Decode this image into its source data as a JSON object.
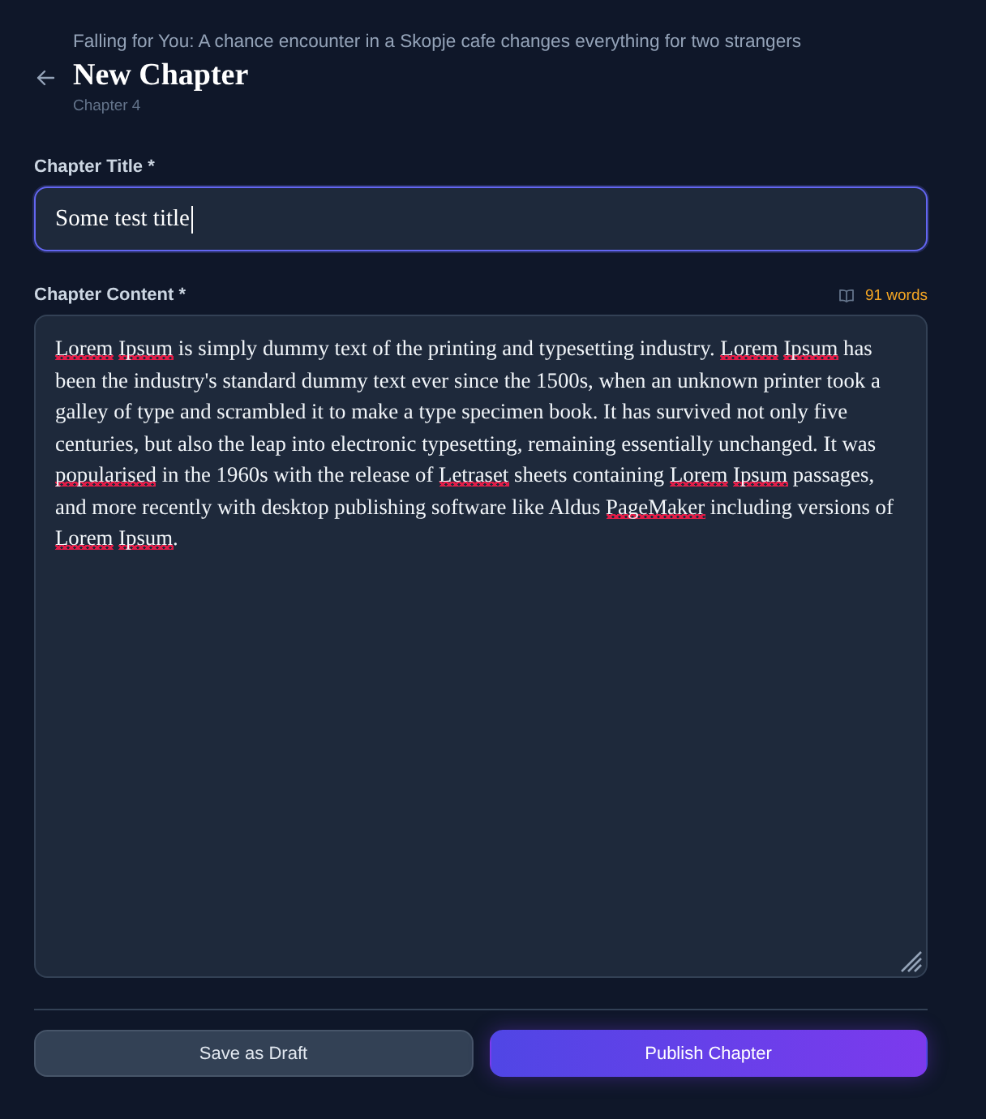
{
  "header": {
    "story_title": "Falling for You: A chance encounter in a Skopje cafe changes everything for two strangers",
    "title": "New Chapter",
    "chapter_label": "Chapter 4"
  },
  "title_field": {
    "label": "Chapter Title *",
    "value": "Some test title",
    "focused": true
  },
  "content_field": {
    "label": "Chapter Content *",
    "word_count": "91 words",
    "segments": [
      {
        "text": "Lorem Ipsum",
        "misspelled": true
      },
      {
        "text": " is simply dummy text of the printing and typesetting industry. ",
        "misspelled": false
      },
      {
        "text": "Lorem Ipsum",
        "misspelled": true
      },
      {
        "text": " has been the industry's standard dummy text ever since the 1500s, when an unknown printer took a galley of type and scrambled it to make a type specimen book. It has survived not only five centuries, but also the leap into electronic typesetting, remaining essentially unchanged. It was ",
        "misspelled": false
      },
      {
        "text": "popularised",
        "misspelled": true
      },
      {
        "text": " in the 1960s with the release of ",
        "misspelled": false
      },
      {
        "text": "Letraset",
        "misspelled": true
      },
      {
        "text": " sheets containing ",
        "misspelled": false
      },
      {
        "text": "Lorem Ipsum",
        "misspelled": true
      },
      {
        "text": " passages, and more recently with desktop publishing software like Aldus ",
        "misspelled": false
      },
      {
        "text": "PageMaker",
        "misspelled": true
      },
      {
        "text": " including versions of ",
        "misspelled": false
      },
      {
        "text": "Lorem Ipsum",
        "misspelled": true
      },
      {
        "text": ".",
        "misspelled": false
      }
    ]
  },
  "buttons": [
    {
      "label": "Save as Draft",
      "kind": "secondary"
    },
    {
      "label": "Publish Chapter",
      "kind": "primary"
    }
  ]
}
